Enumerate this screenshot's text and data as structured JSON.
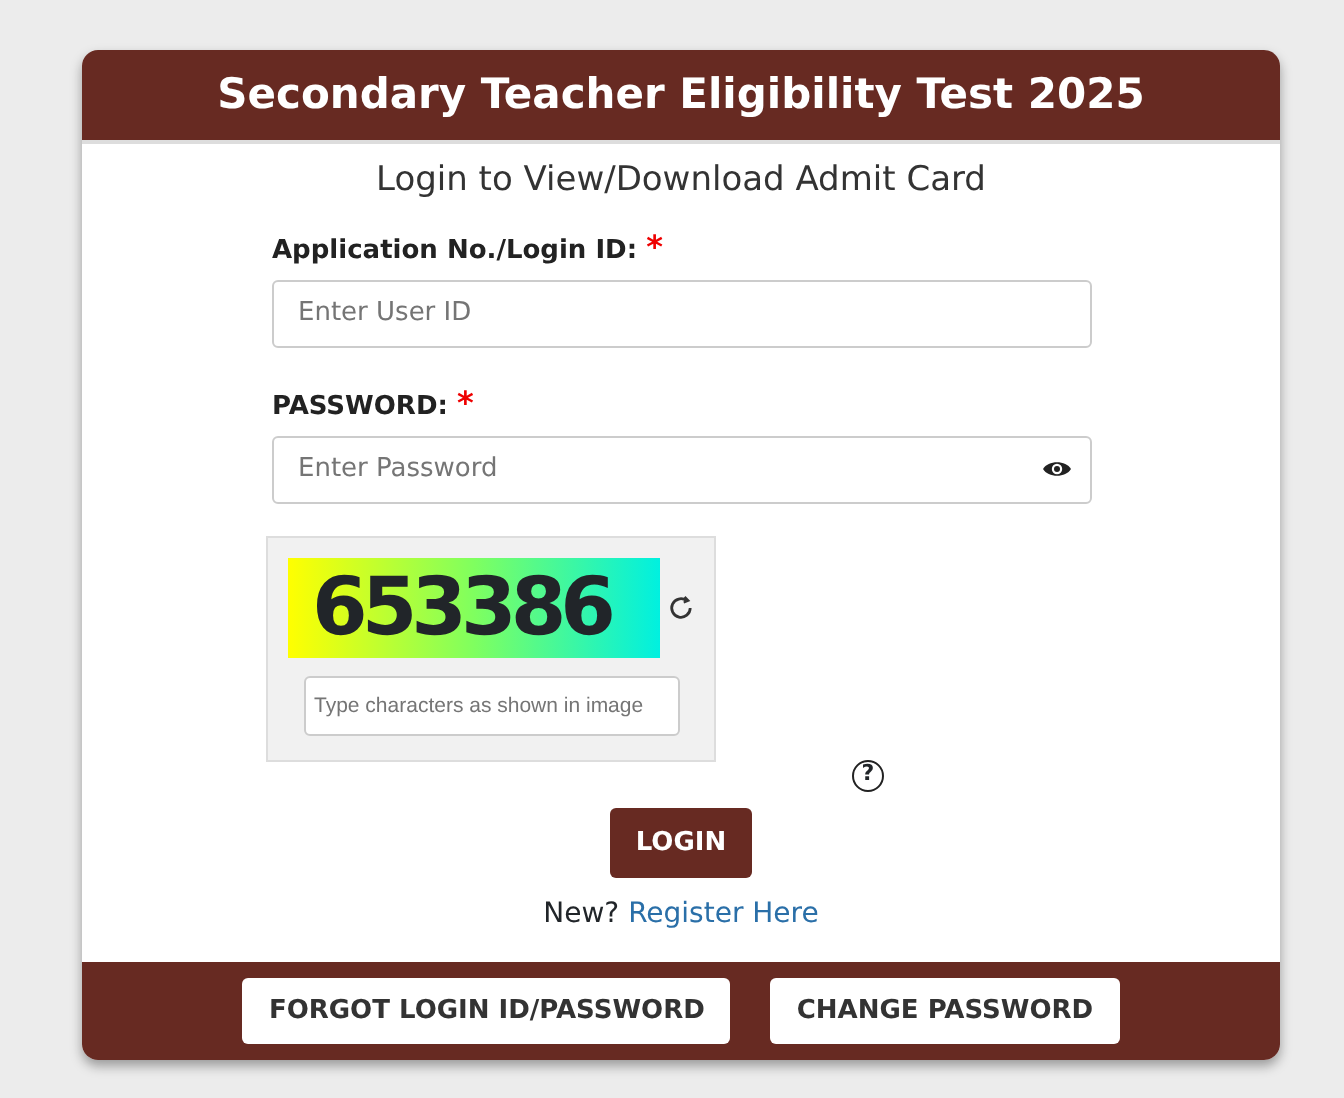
{
  "header": {
    "title": "Secondary Teacher Eligibility Test 2025"
  },
  "form": {
    "subtitle": "Login to View/Download Admit Card",
    "fields": [
      {
        "label": "Application No./Login ID:",
        "required_mark": "*",
        "placeholder": "Enter User ID",
        "kind": "text"
      },
      {
        "label": "PASSWORD:",
        "required_mark": "*",
        "placeholder": "Enter Password",
        "kind": "password"
      }
    ],
    "captcha": {
      "code": "653386",
      "placeholder": "Type characters as shown in image",
      "help": "?"
    },
    "login_button": "LOGIN",
    "register": {
      "prompt": "New?",
      "link": "Register Here"
    }
  },
  "footer": {
    "buttons": [
      "FORGOT LOGIN ID/PASSWORD",
      "CHANGE PASSWORD"
    ]
  }
}
